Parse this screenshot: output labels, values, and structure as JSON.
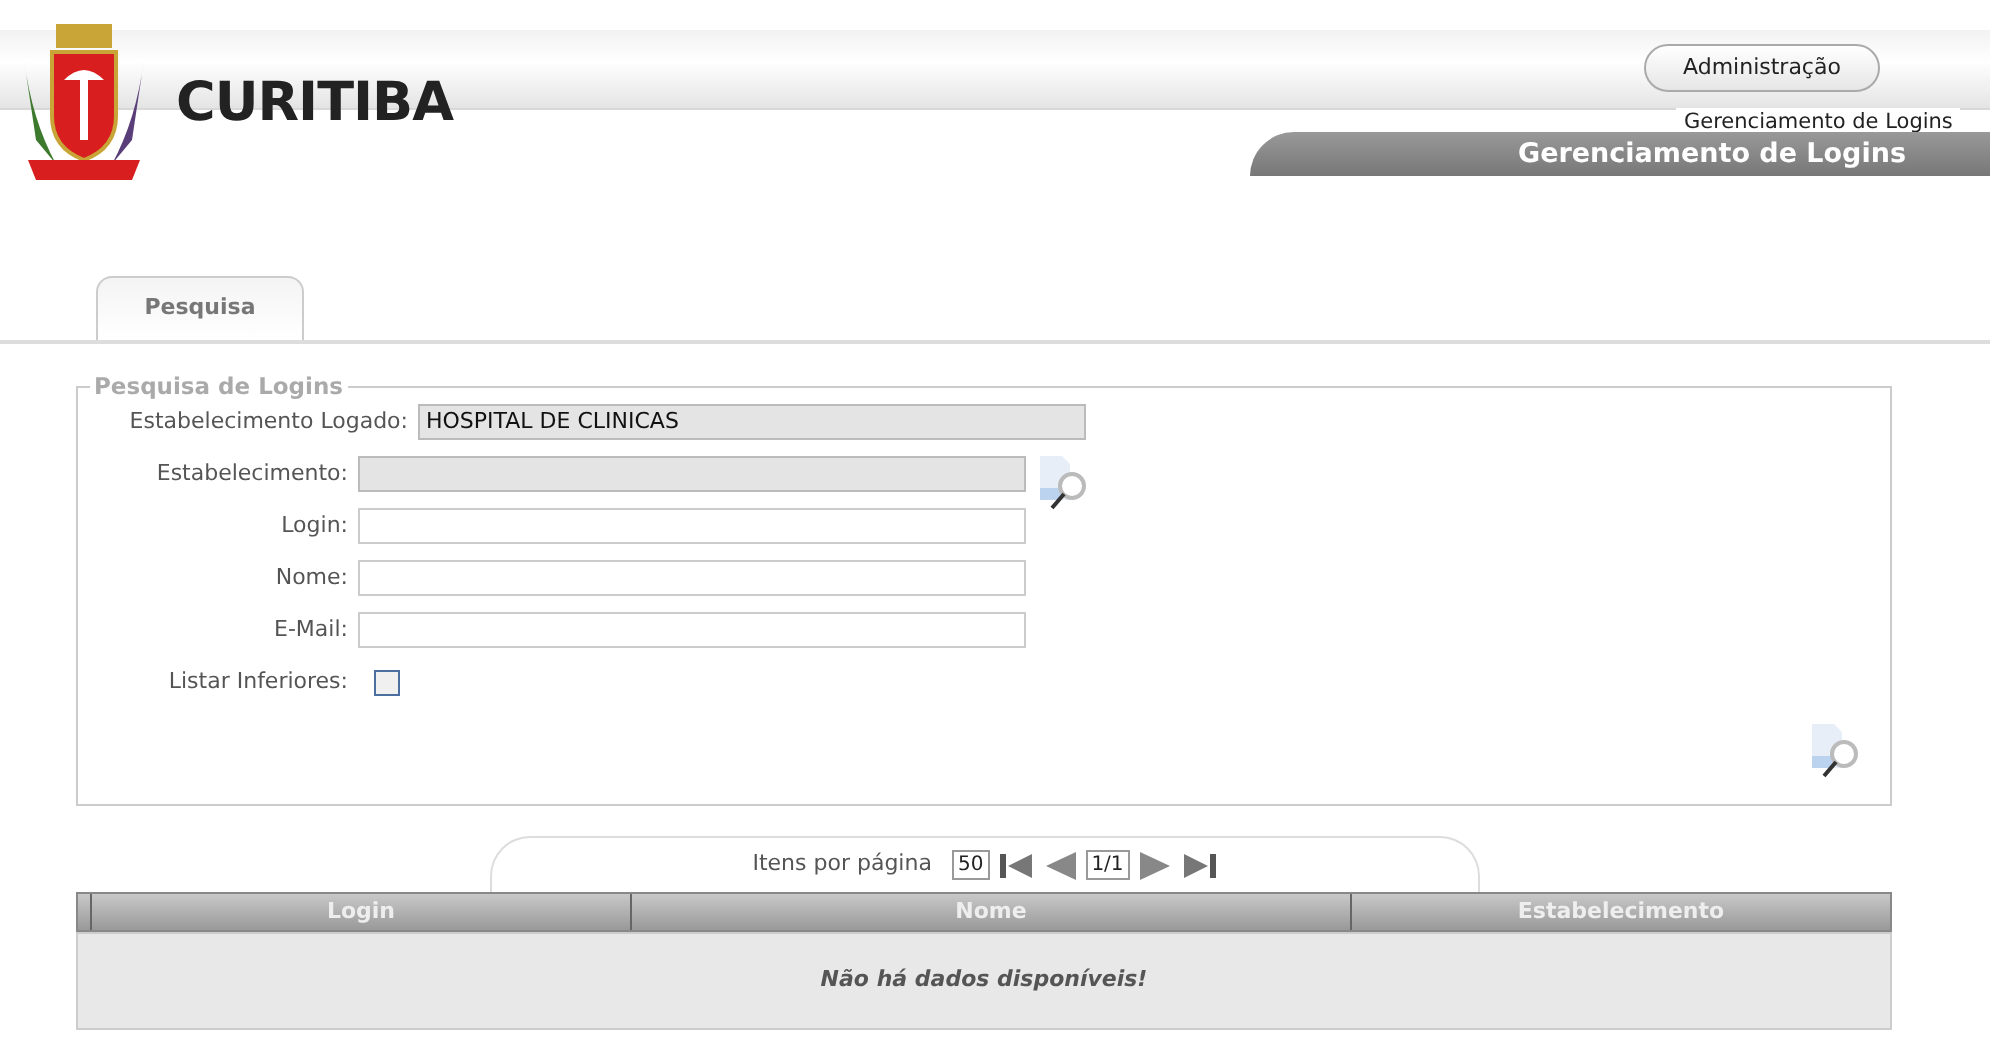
{
  "header": {
    "logo_text": "CURITIBA",
    "admin_button": "Administração",
    "breadcrumb": "Gerenciamento de Logins",
    "page_title": "Gerenciamento de Logins"
  },
  "tabs": [
    {
      "label": "Pesquisa",
      "selected": true
    }
  ],
  "search": {
    "legend": "Pesquisa de Logins",
    "fields": [
      {
        "kind": "session",
        "label": "Estabelecimento Logado:",
        "value": "HOSPITAL DE CLINICAS",
        "disabled": true
      },
      {
        "kind": "lookup",
        "label": "Estabelecimento:",
        "disabled": true
      },
      {
        "kind": "text",
        "label": "Login:",
        "disabled": false
      },
      {
        "kind": "text",
        "label": "Nome:",
        "disabled": false
      },
      {
        "kind": "text",
        "label": "E-Mail:",
        "disabled": false
      },
      {
        "kind": "checkbox",
        "label": "Listar Inferiores:",
        "checked": false
      }
    ]
  },
  "pagination": {
    "label": "Itens por página",
    "per_page": "50",
    "page": "1/1"
  },
  "table": {
    "columns": [
      "Login",
      "Nome",
      "Estabelecimento"
    ],
    "empty_message": "Não há dados disponíveis!"
  }
}
